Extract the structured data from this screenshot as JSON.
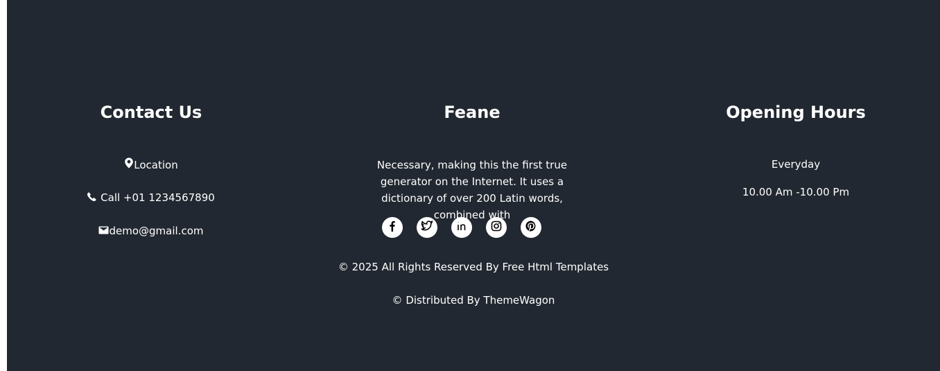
{
  "contact": {
    "heading": "Contact Us",
    "location_label": "Location",
    "call_label": "Call +01 1234567890",
    "email_label": "demo@gmail.com"
  },
  "brand": {
    "heading": "Feane",
    "description": "Necessary, making this the first true generator on the Internet. It uses a dictionary of over 200 Latin words, combined with",
    "social_icons": [
      "facebook-icon",
      "twitter-icon",
      "linkedin-icon",
      "instagram-icon",
      "pinterest-icon"
    ]
  },
  "hours": {
    "heading": "Opening Hours",
    "days": "Everyday",
    "time": "10.00 Am -10.00 Pm"
  },
  "footer": {
    "copyright": "© 2025 All Rights Reserved By Free Html Templates",
    "distributed": "© Distributed By ThemeWagon"
  },
  "colors": {
    "background": "#222831",
    "text": "#ffffff"
  }
}
